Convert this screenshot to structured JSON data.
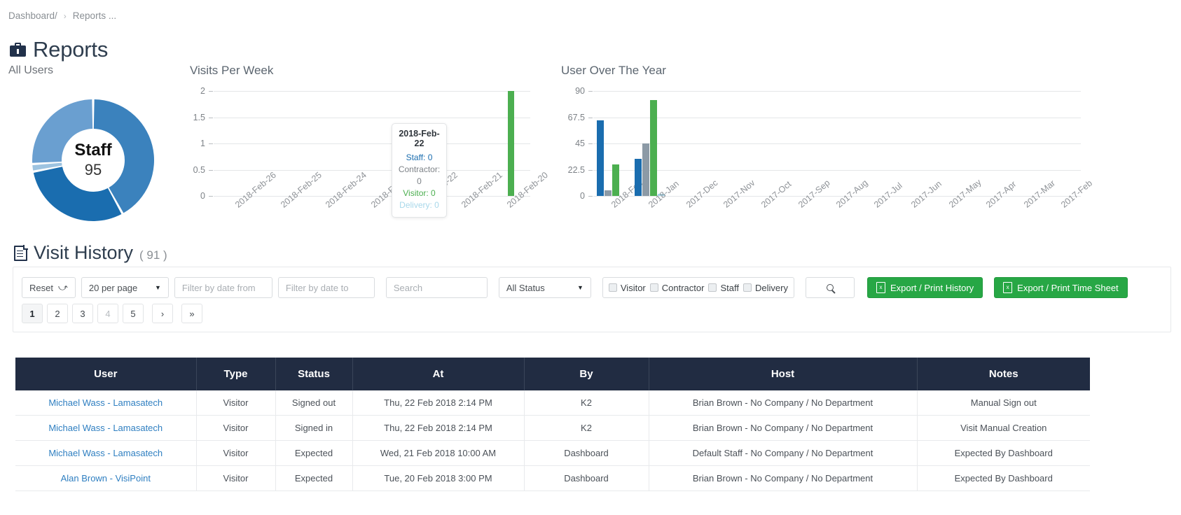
{
  "breadcrumb": {
    "root": "Dashboard/",
    "separator": "›",
    "current": "Reports ..."
  },
  "header": {
    "title": "Reports",
    "subtitle": "All Users",
    "icon": "briefcase-icon"
  },
  "donut": {
    "center_label": "Staff",
    "center_value": "95",
    "segments": [
      {
        "name": "staff",
        "value": 95,
        "color": "#3b82bd",
        "percent": 42
      },
      {
        "name": "contractor",
        "value": 52,
        "color": "#1a6daf",
        "percent": 30
      },
      {
        "name": "visitor",
        "value": 2,
        "color": "#9dc3e0",
        "percent": 2
      },
      {
        "name": "delivery",
        "value": 44,
        "color": "#6a9fd0",
        "percent": 26
      }
    ]
  },
  "chart_data": [
    {
      "type": "bar",
      "title": "Visits Per Week",
      "xlabel": "",
      "ylabel": "",
      "ylim": [
        0,
        2
      ],
      "yticks": [
        "0",
        "0.5",
        "1",
        "1.5",
        "2"
      ],
      "grid": true,
      "categories": [
        "2018-Feb-26",
        "2018-Feb-25",
        "2018-Feb-24",
        "2018-Feb-23",
        "2018-Feb-22",
        "2018-Feb-21",
        "2018-Feb-20"
      ],
      "series": [
        {
          "name": "Staff",
          "color": "#1a6daf",
          "values": [
            0,
            0,
            0,
            0,
            0,
            0,
            0
          ]
        },
        {
          "name": "Contractor",
          "color": "#8c9aa6",
          "values": [
            0,
            0,
            0,
            0,
            0,
            0,
            0
          ]
        },
        {
          "name": "Visitor",
          "color": "#4caf50",
          "values": [
            0,
            0,
            0,
            0,
            0,
            0,
            2
          ]
        },
        {
          "name": "Delivery",
          "color": "#a8d8ea",
          "values": [
            0,
            0,
            0,
            0,
            0,
            0,
            0
          ]
        }
      ],
      "tooltip": {
        "title": "2018-Feb-22",
        "rows": [
          {
            "label": "Staff: 0",
            "color": "#1a6daf"
          },
          {
            "label": "Contractor: 0",
            "color": "#7d8287"
          },
          {
            "label": "Visitor: 0",
            "color": "#4caf50"
          },
          {
            "label": "Delivery: 0",
            "color": "#a8d8ea"
          }
        ]
      }
    },
    {
      "type": "bar",
      "title": "User Over The Year",
      "xlabel": "",
      "ylabel": "",
      "ylim": [
        0,
        90
      ],
      "yticks": [
        "0",
        "22.5",
        "45",
        "67.5",
        "90"
      ],
      "grid": true,
      "categories": [
        "2018-Feb",
        "2018-Jan",
        "2017-Dec",
        "2017-Nov",
        "2017-Oct",
        "2017-Sep",
        "2017-Aug",
        "2017-Jul",
        "2017-Jun",
        "2017-May",
        "2017-Apr",
        "2017-Mar",
        "2017-Feb"
      ],
      "series": [
        {
          "name": "Staff",
          "color": "#1a6daf",
          "values": [
            65,
            32,
            0,
            0,
            0,
            0,
            0,
            0,
            0,
            0,
            0,
            0,
            0
          ]
        },
        {
          "name": "Contractor",
          "color": "#8c9aa6",
          "values": [
            5,
            45,
            0,
            0,
            0,
            0,
            0,
            0,
            0,
            0,
            0,
            0,
            0
          ]
        },
        {
          "name": "Visitor",
          "color": "#4caf50",
          "values": [
            27,
            82,
            0,
            0,
            0,
            0,
            0,
            0,
            0,
            0,
            0,
            0,
            0
          ]
        },
        {
          "name": "Delivery",
          "color": "#a8d8ea",
          "values": [
            0,
            2,
            0,
            0,
            0,
            0,
            0,
            0,
            0,
            0,
            0,
            0,
            0
          ]
        }
      ]
    }
  ],
  "visit_history": {
    "title": "Visit History",
    "count": "( 91 )",
    "icon": "document-icon"
  },
  "toolbar": {
    "reset_label": "Reset",
    "reset_icon": "redo-arrow-icon",
    "per_page_value": "20 per page",
    "date_from_placeholder": "Filter by date from",
    "date_from_value": "",
    "date_to_placeholder": "Filter by date to",
    "date_to_value": "",
    "search_placeholder": "Search",
    "search_value": "",
    "status_value": "All Status",
    "type_filters": [
      {
        "label": "Visitor",
        "checked": false
      },
      {
        "label": "Contractor",
        "checked": false
      },
      {
        "label": "Staff",
        "checked": false
      },
      {
        "label": "Delivery",
        "checked": false
      }
    ],
    "search_button_icon": "search-icon",
    "export_history_label": "Export / Print History",
    "export_timesheet_label": "Export / Print Time Sheet",
    "export_icon": "excel-file-icon",
    "green": "#27a745"
  },
  "pagination": {
    "pages": [
      "1",
      "2",
      "3",
      "4",
      "5"
    ],
    "active": "1",
    "next_label": "›",
    "last_label": "»"
  },
  "table": {
    "columns": [
      "User",
      "Type",
      "Status",
      "At",
      "By",
      "Host",
      "Notes"
    ],
    "rows": [
      {
        "user": "Michael Wass - Lamasatech",
        "type": "Visitor",
        "status": "Signed out",
        "at": "Thu, 22 Feb 2018 2:14 PM",
        "by": "K2",
        "host": "Brian Brown - No Company / No Department",
        "notes": "Manual Sign out"
      },
      {
        "user": "Michael Wass - Lamasatech",
        "type": "Visitor",
        "status": "Signed in",
        "at": "Thu, 22 Feb 2018 2:14 PM",
        "by": "K2",
        "host": "Brian Brown - No Company / No Department",
        "notes": "Visit Manual Creation"
      },
      {
        "user": "Michael Wass - Lamasatech",
        "type": "Visitor",
        "status": "Expected",
        "at": "Wed, 21 Feb 2018 10:00 AM",
        "by": "Dashboard",
        "host": "Default Staff - No Company / No Department",
        "notes": "Expected By Dashboard"
      },
      {
        "user": "Alan Brown - VisiPoint",
        "type": "Visitor",
        "status": "Expected",
        "at": "Tue, 20 Feb 2018 3:00 PM",
        "by": "Dashboard",
        "host": "Brian Brown - No Company / No Department",
        "notes": "Expected By Dashboard"
      }
    ]
  }
}
